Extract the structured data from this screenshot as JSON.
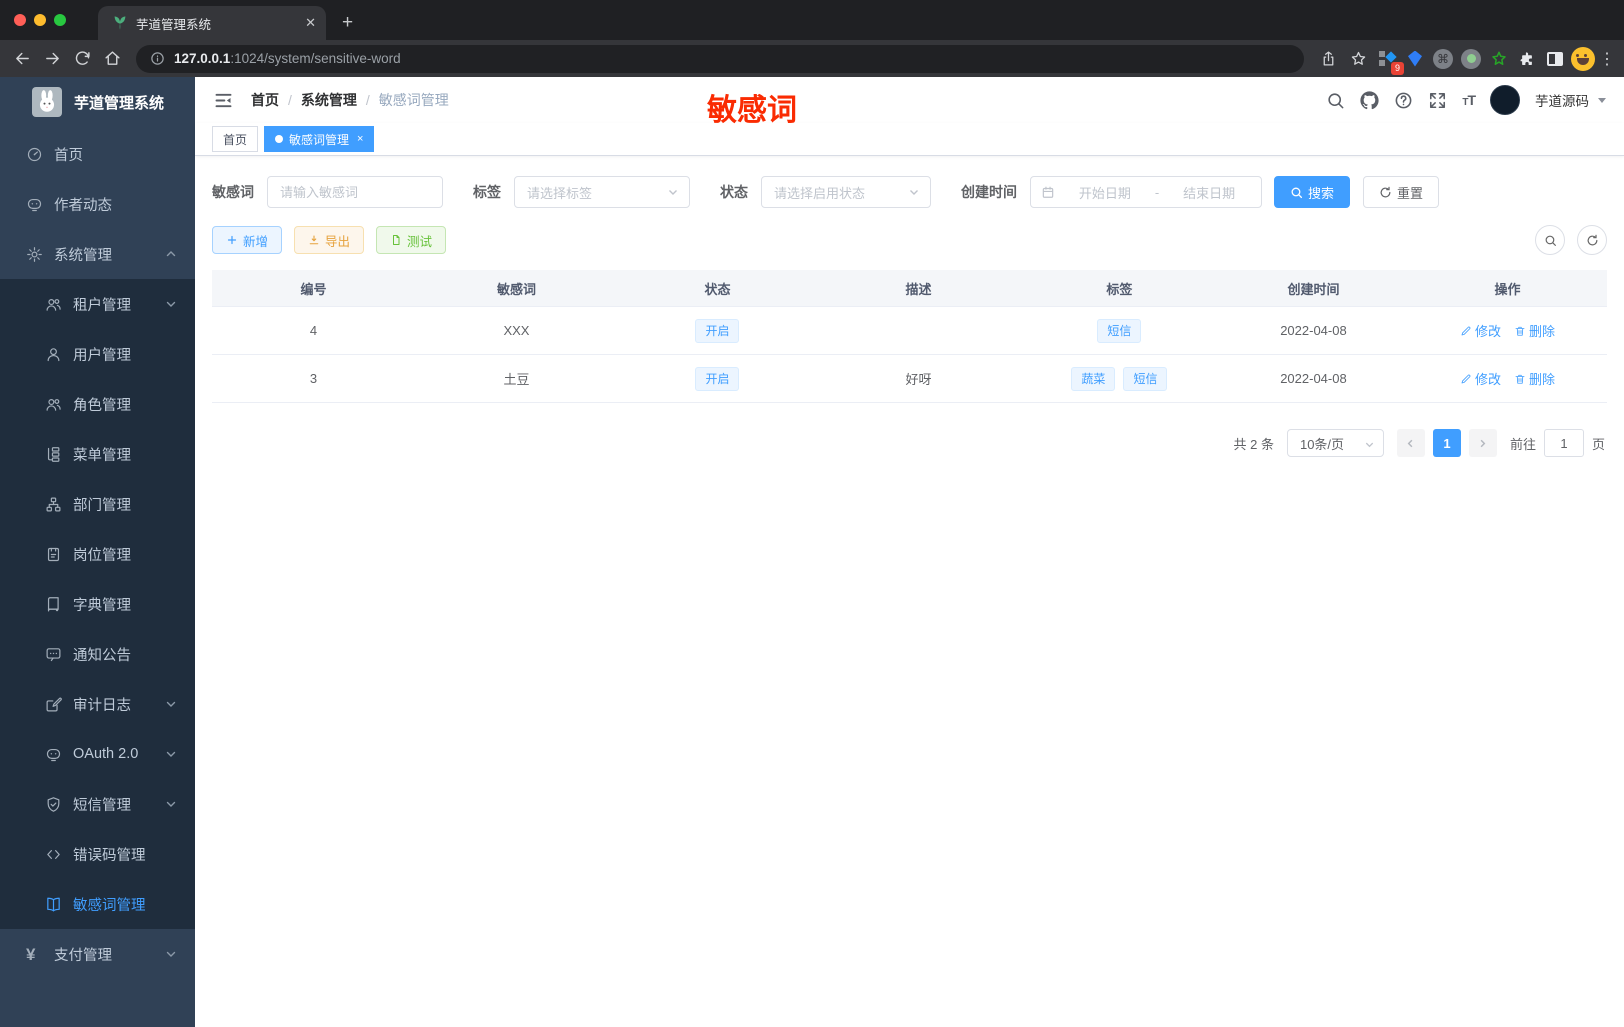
{
  "browser": {
    "tab": {
      "title": "芋道管理系统"
    },
    "url": {
      "host": "127.0.0.1",
      "path": ":1024/system/sensitive-word"
    },
    "extension_badge": "9",
    "new_tab_label": "+"
  },
  "sidebar": {
    "logo_title": "芋道管理系统",
    "items": [
      {
        "label": "首页",
        "icon": "gauge-icon",
        "level": 1
      },
      {
        "label": "作者动态",
        "icon": "chat-face-icon",
        "level": 1
      },
      {
        "label": "系统管理",
        "icon": "gear-icon",
        "level": 1,
        "chevron": "up"
      },
      {
        "label": "租户管理",
        "icon": "users-icon",
        "level": 2,
        "chevron": "down"
      },
      {
        "label": "用户管理",
        "icon": "user-icon",
        "level": 2
      },
      {
        "label": "角色管理",
        "icon": "users-icon",
        "level": 2
      },
      {
        "label": "菜单管理",
        "icon": "tree-icon",
        "level": 2
      },
      {
        "label": "部门管理",
        "icon": "org-icon",
        "level": 2
      },
      {
        "label": "岗位管理",
        "icon": "badge-icon",
        "level": 2
      },
      {
        "label": "字典管理",
        "icon": "book-icon",
        "level": 2
      },
      {
        "label": "通知公告",
        "icon": "comment-icon",
        "level": 2
      },
      {
        "label": "审计日志",
        "icon": "log-icon",
        "level": 2,
        "chevron": "down"
      },
      {
        "label": "OAuth 2.0",
        "icon": "chat-face-icon",
        "level": 2,
        "chevron": "down"
      },
      {
        "label": "短信管理",
        "icon": "shield-icon",
        "level": 2,
        "chevron": "down"
      },
      {
        "label": "错误码管理",
        "icon": "code-icon",
        "level": 2
      },
      {
        "label": "敏感词管理",
        "icon": "open-book-icon",
        "level": 2,
        "active": true
      },
      {
        "label": "支付管理",
        "icon": "yen-icon",
        "level": 1,
        "chevron": "down"
      }
    ]
  },
  "header": {
    "breadcrumb": [
      "首页",
      "系统管理",
      "敏感词管理"
    ],
    "watermark": "敏感词",
    "user": "芋道源码"
  },
  "tabs": [
    {
      "label": "首页",
      "active": false
    },
    {
      "label": "敏感词管理",
      "active": true,
      "closable": true
    }
  ],
  "filters": {
    "word": {
      "label": "敏感词",
      "placeholder": "请输入敏感词"
    },
    "tag": {
      "label": "标签",
      "placeholder": "请选择标签"
    },
    "status": {
      "label": "状态",
      "placeholder": "请选择启用状态"
    },
    "create_time": {
      "label": "创建时间",
      "start_placeholder": "开始日期",
      "separator": "-",
      "end_placeholder": "结束日期"
    },
    "search_label": "搜索",
    "reset_label": "重置"
  },
  "toolbar": {
    "add_label": "新增",
    "export_label": "导出",
    "test_label": "测试"
  },
  "table": {
    "columns": [
      "编号",
      "敏感词",
      "状态",
      "描述",
      "标签",
      "创建时间",
      "操作"
    ],
    "rows": [
      {
        "id": "4",
        "word": "XXX",
        "status": "开启",
        "description": "",
        "tags": [
          "短信"
        ],
        "created": "2022-04-08"
      },
      {
        "id": "3",
        "word": "土豆",
        "status": "开启",
        "description": "好呀",
        "tags": [
          "蔬菜",
          "短信"
        ],
        "created": "2022-04-08"
      }
    ],
    "actions": {
      "edit": "修改",
      "delete": "删除"
    }
  },
  "pagination": {
    "total_text": "共 2 条",
    "page_size": "10条/页",
    "current_page": "1",
    "goto_label": "前往",
    "goto_value": "1",
    "goto_suffix": "页"
  },
  "colors": {
    "accent": "#409eff",
    "watermark_red": "#fa2b02"
  }
}
